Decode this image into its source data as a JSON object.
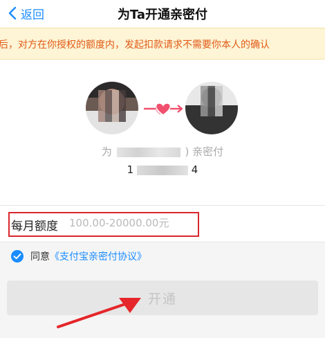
{
  "nav": {
    "back_label": "返回",
    "title": "为Ta开通亲密付"
  },
  "notice": {
    "text": "后，对方在你授权的额度内，发起扣款请求不需要你本人的确认"
  },
  "profile": {
    "label_prefix": "为",
    "label_suffix": ")  亲密付",
    "account_prefix": "1",
    "account_suffix": "4"
  },
  "limit": {
    "label": "每月额度",
    "placeholder": "100.00-20000.00元"
  },
  "agreement": {
    "text": "同意",
    "link": "《支付宝亲密付协议》"
  },
  "open_button": {
    "label": "开通"
  },
  "colors": {
    "accent": "#1a8cff",
    "notice_text": "#e25b18",
    "highlight": "#d9262c",
    "heart": "#f0506e"
  }
}
